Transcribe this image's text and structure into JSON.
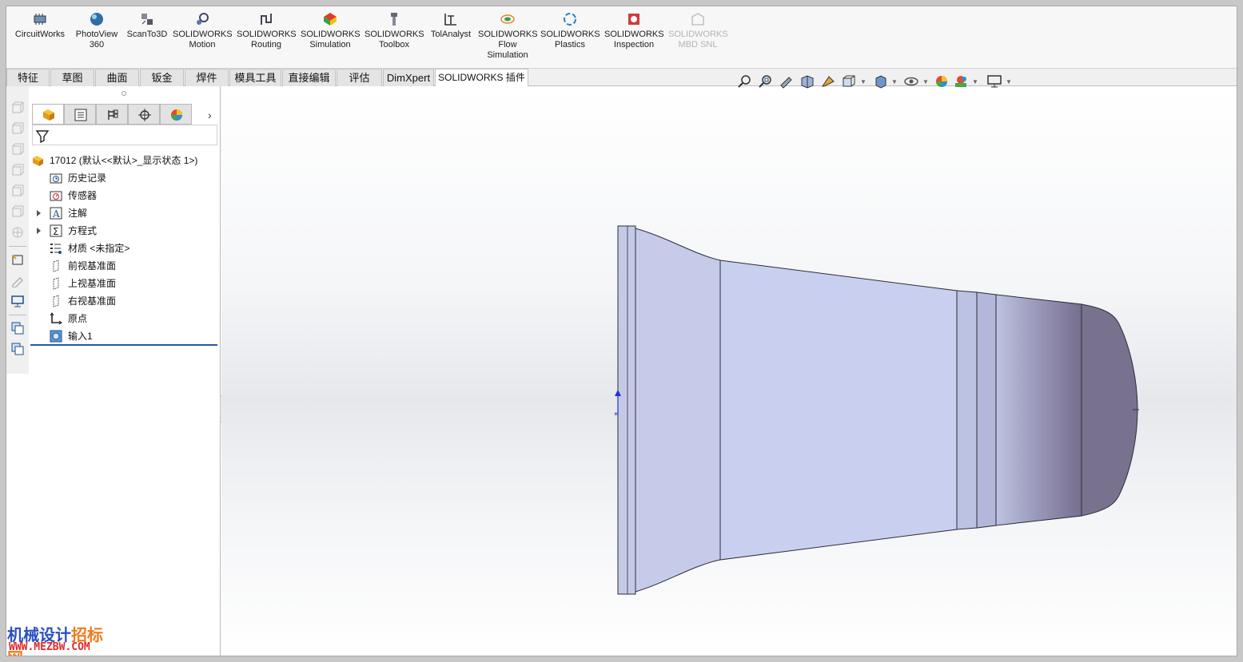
{
  "colors": {
    "accent_blue": "#1f5aa6",
    "part_light": "#c7cdea",
    "part_dark": "#7a7393",
    "watermark_blue": "#2a4fc0",
    "watermark_orange": "#f07a1a",
    "watermark_url": "#e02828"
  },
  "ribbon": {
    "addins": [
      {
        "label": "CircuitWorks",
        "icon": "circuitworks-icon",
        "enabled": true
      },
      {
        "label": "PhotoView\n360",
        "icon": "photoview-icon",
        "enabled": true
      },
      {
        "label": "ScanTo3D",
        "icon": "scanto3d-icon",
        "enabled": true
      },
      {
        "label": "SOLIDWORKS\nMotion",
        "icon": "motion-icon",
        "enabled": true
      },
      {
        "label": "SOLIDWORKS\nRouting",
        "icon": "routing-icon",
        "enabled": true
      },
      {
        "label": "SOLIDWORKS\nSimulation",
        "icon": "simulation-icon",
        "enabled": true
      },
      {
        "label": "SOLIDWORKS\nToolbox",
        "icon": "toolbox-icon",
        "enabled": true
      },
      {
        "label": "TolAnalyst",
        "icon": "tolanalyst-icon",
        "enabled": true
      },
      {
        "label": "SOLIDWORKS\nFlow\nSimulation",
        "icon": "flow-simulation-icon",
        "enabled": true
      },
      {
        "label": "SOLIDWORKS\nPlastics",
        "icon": "plastics-icon",
        "enabled": true
      },
      {
        "label": "SOLIDWORKS\nInspection",
        "icon": "inspection-icon",
        "enabled": true
      },
      {
        "label": "SOLIDWORKS\nMBD SNL",
        "icon": "mbd-snl-icon",
        "enabled": false
      }
    ]
  },
  "tabs": [
    {
      "label": "特征",
      "active": false
    },
    {
      "label": "草图",
      "active": false
    },
    {
      "label": "曲面",
      "active": false
    },
    {
      "label": "钣金",
      "active": false
    },
    {
      "label": "焊件",
      "active": false
    },
    {
      "label": "模具工具",
      "active": false
    },
    {
      "label": "直接编辑",
      "active": false
    },
    {
      "label": "评估",
      "active": false
    },
    {
      "label": "DimXpert",
      "active": false
    },
    {
      "label": "SOLIDWORKS 插件",
      "active": true
    }
  ],
  "hud_toolbar": {
    "icons": [
      "zoom-to-fit-icon",
      "zoom-to-area-icon",
      "previous-view-icon",
      "section-view-icon",
      "dynamic-annotation-icon",
      "view-orientation-icon",
      "display-style-icon",
      "hide-show-items-icon",
      "edit-appearance-icon",
      "apply-scene-icon",
      "view-settings-icon"
    ]
  },
  "feature_tree": {
    "root_label": "17012 (默认<<默认>_显示状态 1>)",
    "items": [
      {
        "label": "历史记录",
        "icon": "history-icon",
        "expandable": false
      },
      {
        "label": "传感器",
        "icon": "sensors-icon",
        "expandable": false
      },
      {
        "label": "注解",
        "icon": "annotations-icon",
        "expandable": true
      },
      {
        "label": "方程式",
        "icon": "equations-icon",
        "expandable": true
      },
      {
        "label": "材质 <未指定>",
        "icon": "material-icon",
        "expandable": false
      },
      {
        "label": "前视基准面",
        "icon": "front-plane-icon",
        "expandable": false
      },
      {
        "label": "上视基准面",
        "icon": "top-plane-icon",
        "expandable": false
      },
      {
        "label": "右视基准面",
        "icon": "right-plane-icon",
        "expandable": false
      },
      {
        "label": "原点",
        "icon": "origin-icon",
        "expandable": false
      },
      {
        "label": "输入1",
        "icon": "imported-body-icon",
        "expandable": false
      }
    ]
  },
  "watermark": {
    "text_part1": "机械设计",
    "text_part2": "招标网",
    "url": "WWW.MEZBW.COM"
  }
}
